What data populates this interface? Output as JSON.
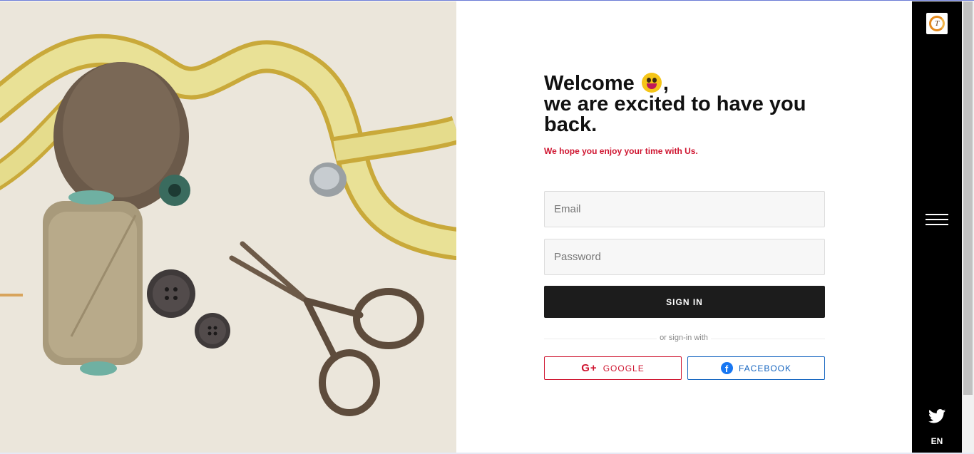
{
  "hero": {
    "alt": "sewing supplies: measuring tape, thread spools, buttons and scissors"
  },
  "form": {
    "headline_line1": "Welcome",
    "headline_comma": ",",
    "headline_line2": "we are excited to have you back.",
    "subtitle": "We hope you enjoy your time with Us.",
    "email_placeholder": "Email",
    "password_placeholder": "Password",
    "signin_label": "SIGN IN",
    "divider_text": "or sign-in with",
    "google_label": "GOOGLE",
    "facebook_label": "FACEBOOK",
    "google_icon": "G+",
    "facebook_icon": "f"
  },
  "rail": {
    "logo_letter": "T",
    "language": "EN"
  },
  "colors": {
    "accent_red": "#cf1530",
    "facebook_blue": "#1565c0",
    "signin_bg": "#1c1c1c",
    "rail_bg": "#000000"
  },
  "icons": [
    "smiley-emoji-icon",
    "google-plus-icon",
    "facebook-icon",
    "hamburger-menu-icon",
    "twitter-icon"
  ]
}
